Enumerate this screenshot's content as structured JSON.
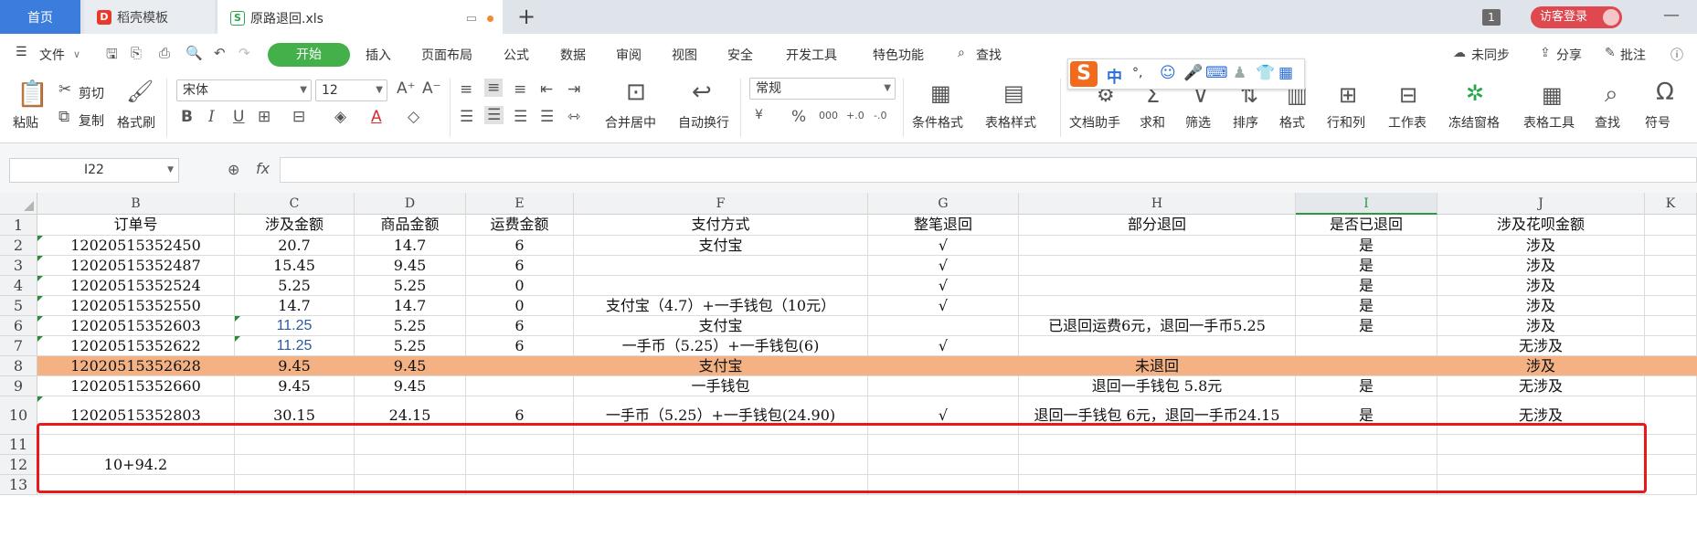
{
  "tabs": {
    "home": "首页",
    "template": "稻壳模板",
    "file": "原路退回.xls",
    "new_tab": "+",
    "count_badge": "1",
    "login": "访客登录"
  },
  "menubar": {
    "file": "文件",
    "items": [
      "开始",
      "插入",
      "页面布局",
      "公式",
      "数据",
      "审阅",
      "视图",
      "安全",
      "开发工具",
      "特色功能"
    ],
    "search": "查找",
    "right": [
      "未同步",
      "分享",
      "批注"
    ]
  },
  "ribbon": {
    "paste": "粘贴",
    "cut": "剪切",
    "copy": "复制",
    "format_painter": "格式刷",
    "font_name": "宋体",
    "font_size": "12",
    "merge_center": "合并居中",
    "auto_wrap": "自动换行",
    "number_format": "常规",
    "cond_format": "条件格式",
    "table_style": "表格样式",
    "doc_assist": "文档助手",
    "sum": "求和",
    "filter": "筛选",
    "sort": "排序",
    "format": "格式",
    "row_col": "行和列",
    "worksheet": "工作表",
    "freeze": "冻结窗格",
    "table_tools": "表格工具",
    "find": "查找",
    "symbol": "符号",
    "num_btns": [
      "¥",
      "%",
      "000",
      "+.0",
      "-.0"
    ]
  },
  "ime": {
    "mode": "中",
    "punct": "°,"
  },
  "formula_bar": {
    "cell_ref": "I22",
    "fx": "fx",
    "value": ""
  },
  "columns": [
    "B",
    "C",
    "D",
    "E",
    "F",
    "G",
    "H",
    "I",
    "J",
    "K"
  ],
  "selected_column": "I",
  "row_numbers": [
    "1",
    "2",
    "3",
    "4",
    "5",
    "6",
    "7",
    "8",
    "9",
    "10",
    "11",
    "12",
    "13"
  ],
  "rows": [
    [
      "订单号",
      "涉及金额",
      "商品金额",
      "运费金额",
      "支付方式",
      "整笔退回",
      "部分退回",
      "是否已退回",
      "涉及花呗金额"
    ],
    [
      "12020515352450",
      "20.7",
      "14.7",
      "6",
      "支付宝",
      "√",
      "",
      "是",
      "涉及"
    ],
    [
      "12020515352487",
      "15.45",
      "9.45",
      "6",
      "",
      "√",
      "",
      "是",
      "涉及"
    ],
    [
      "12020515352524",
      "5.25",
      "5.25",
      "0",
      "",
      "√",
      "",
      "是",
      "涉及"
    ],
    [
      "12020515352550",
      "14.7",
      "14.7",
      "0",
      "支付宝（4.7）+一手钱包（10元）",
      "√",
      "",
      "是",
      "涉及"
    ],
    [
      "12020515352603",
      "11.25",
      "5.25",
      "6",
      "支付宝",
      "",
      "已退回运费6元，退回一手币5.25",
      "是",
      "涉及"
    ],
    [
      "12020515352622",
      "11.25",
      "5.25",
      "6",
      "一手币（5.25）+一手钱包(6)",
      "√",
      "",
      "",
      "无涉及"
    ],
    [
      "12020515352628",
      "9.45",
      "9.45",
      "",
      "支付宝",
      "",
      "未退回",
      "",
      "涉及"
    ],
    [
      "12020515352660",
      "9.45",
      "9.45",
      "",
      "一手钱包",
      "",
      "退回一手钱包 5.8元",
      "是",
      "无涉及"
    ],
    [
      "12020515352803",
      "30.15",
      "24.15",
      "6",
      "一手币（5.25）+一手钱包(24.90)",
      "√",
      "退回一手钱包 6元，退回一手币24.15",
      "是",
      "无涉及"
    ],
    [
      "",
      "",
      "",
      "",
      "",
      "",
      "",
      "",
      ""
    ],
    [
      "10+94.2",
      "",
      "",
      "",
      "",
      "",
      "",
      "",
      ""
    ],
    [
      "",
      "",
      "",
      "",
      "",
      "",
      "",
      "",
      ""
    ]
  ],
  "highlight_row": 8,
  "outlined_row": 10
}
